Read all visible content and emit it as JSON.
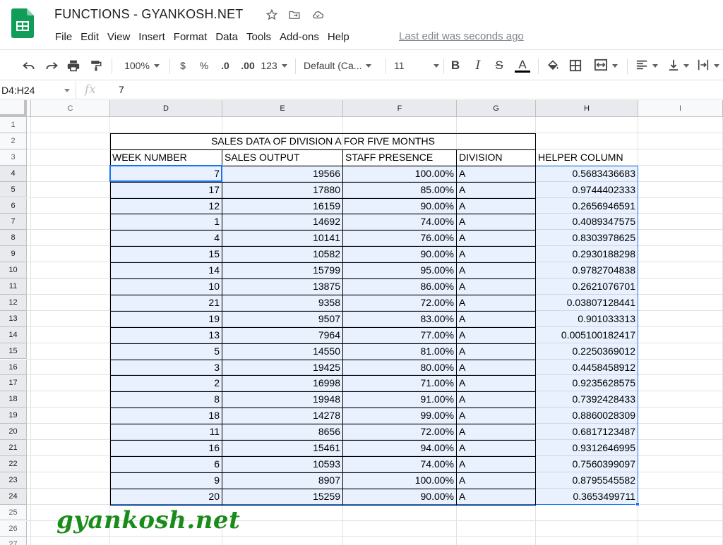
{
  "app": {
    "doc_title": "FUNCTIONS - GYANKOSH.NET",
    "last_edit": "Last edit was seconds ago",
    "menu": [
      "File",
      "Edit",
      "View",
      "Insert",
      "Format",
      "Data",
      "Tools",
      "Add-ons",
      "Help"
    ]
  },
  "toolbar": {
    "zoom": "100%",
    "currency": "$",
    "percent": "%",
    "dec_less": ".0",
    "dec_more": ".00",
    "more_formats": "123",
    "font": "Default (Ca...",
    "font_size": "11",
    "bold": "B",
    "italic": "I",
    "strike": "S",
    "text_color": "A"
  },
  "formula_bar": {
    "name_box": "D4:H24",
    "fx": "fx",
    "value": "7"
  },
  "sheet": {
    "columns": [
      "C",
      "D",
      "E",
      "F",
      "G",
      "H",
      "I"
    ],
    "rows": [
      "1",
      "2",
      "3",
      "4",
      "5",
      "6",
      "7",
      "8",
      "9",
      "10",
      "11",
      "12",
      "13",
      "14",
      "15",
      "16",
      "17",
      "18",
      "19",
      "20",
      "21",
      "22",
      "23",
      "24",
      "25",
      "26",
      "27"
    ],
    "table_title": "SALES DATA OF DIVISION A FOR FIVE MONTHS",
    "headers": [
      "WEEK NUMBER",
      "SALES OUTPUT",
      "STAFF PRESENCE",
      "DIVISION",
      "HELPER COLUMN"
    ],
    "data": [
      [
        "7",
        "19566",
        "100.00%",
        "A",
        "0.5683436683"
      ],
      [
        "17",
        "17880",
        "85.00%",
        "A",
        "0.9744402333"
      ],
      [
        "12",
        "16159",
        "90.00%",
        "A",
        "0.2656946591"
      ],
      [
        "1",
        "14692",
        "74.00%",
        "A",
        "0.4089347575"
      ],
      [
        "4",
        "10141",
        "76.00%",
        "A",
        "0.8303978625"
      ],
      [
        "15",
        "10582",
        "90.00%",
        "A",
        "0.2930188298"
      ],
      [
        "14",
        "15799",
        "95.00%",
        "A",
        "0.9782704838"
      ],
      [
        "10",
        "13875",
        "86.00%",
        "A",
        "0.2621076701"
      ],
      [
        "21",
        "9358",
        "72.00%",
        "A",
        "0.03807128441"
      ],
      [
        "19",
        "9507",
        "83.00%",
        "A",
        "0.901033313"
      ],
      [
        "13",
        "7964",
        "77.00%",
        "A",
        "0.005100182417"
      ],
      [
        "5",
        "14550",
        "81.00%",
        "A",
        "0.2250369012"
      ],
      [
        "3",
        "19425",
        "80.00%",
        "A",
        "0.4458458912"
      ],
      [
        "2",
        "16998",
        "71.00%",
        "A",
        "0.9235628575"
      ],
      [
        "8",
        "19948",
        "91.00%",
        "A",
        "0.7392428433"
      ],
      [
        "18",
        "14278",
        "99.00%",
        "A",
        "0.8860028309"
      ],
      [
        "11",
        "8656",
        "72.00%",
        "A",
        "0.6817123487"
      ],
      [
        "16",
        "15461",
        "94.00%",
        "A",
        "0.9312646995"
      ],
      [
        "6",
        "10593",
        "74.00%",
        "A",
        "0.7560399097"
      ],
      [
        "9",
        "8907",
        "100.00%",
        "A",
        "0.8795545582"
      ],
      [
        "20",
        "15259",
        "90.00%",
        "A",
        "0.3653499711"
      ]
    ]
  },
  "watermark": "gyankosh.net",
  "colors": {
    "selection": "#1a73e8",
    "watermark": "#1a8c1a",
    "sheets_green": "#0f9d58"
  }
}
